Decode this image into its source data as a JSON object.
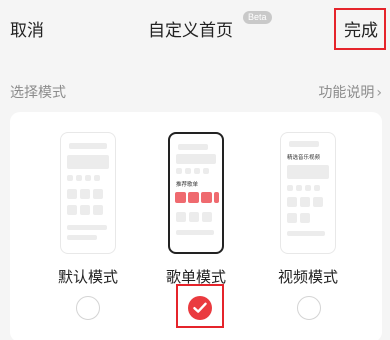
{
  "header": {
    "cancel_label": "取消",
    "title": "自定义首页",
    "beta_badge": "Beta",
    "done_label": "完成"
  },
  "section": {
    "label": "选择模式",
    "help_link": "功能说明"
  },
  "modes": [
    {
      "label": "默认模式",
      "selected": false,
      "preview_title": ""
    },
    {
      "label": "歌单模式",
      "selected": true,
      "preview_title": "推荐歌单"
    },
    {
      "label": "视频模式",
      "selected": false,
      "preview_title": "精选音乐视频"
    }
  ],
  "colors": {
    "accent": "#ea3a3f",
    "highlight_box": "#e5242b",
    "muted_text": "#8c8c8c"
  },
  "icons": {
    "help_chevron": "chevron-right-icon",
    "selected_check": "check-icon"
  }
}
